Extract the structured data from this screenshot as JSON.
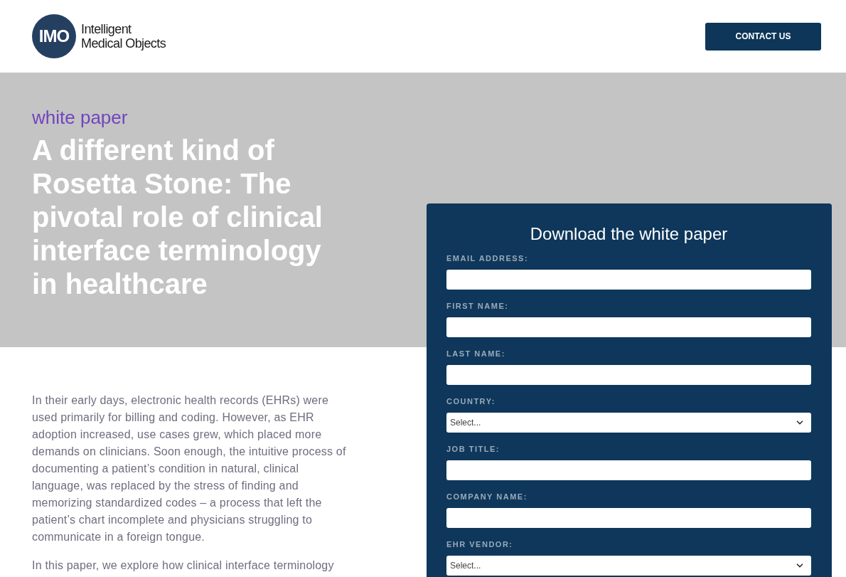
{
  "header": {
    "logo": {
      "mark": "IMO",
      "wordmark": [
        "Intelligent",
        "Medical Objects"
      ]
    },
    "contact_button": "CONTACT US"
  },
  "hero": {
    "eyebrow": "white paper",
    "title": "A different kind of Rosetta Stone: The pivotal role of clinical interface terminology in healthcare"
  },
  "body": {
    "paragraphs": [
      "In their early days, electronic health records (EHRs) were used primarily for billing and coding. However, as EHR adoption increased, use cases grew, which placed more demands on clinicians. Soon enough, the intuitive process of documenting a patient’s condition in natural, clinical language, was replaced by the stress of finding and memorizing standardized codes – a process that left the patient’s chart incomplete and physicians struggling to communicate in a foreign tongue.",
      "In this paper, we explore how clinical interface terminology"
    ]
  },
  "form": {
    "title": "Download the white paper",
    "fields": [
      {
        "kind": "text",
        "label": "EMAIL ADDRESS:"
      },
      {
        "kind": "text",
        "label": "FIRST NAME:"
      },
      {
        "kind": "text",
        "label": "LAST NAME:"
      },
      {
        "kind": "select",
        "label": "COUNTRY:",
        "value": "Select..."
      },
      {
        "kind": "text",
        "label": "JOB TITLE:"
      },
      {
        "kind": "text",
        "label": "COMPANY NAME:"
      },
      {
        "kind": "select",
        "label": "EHR VENDOR:",
        "value": "Select..."
      }
    ]
  }
}
